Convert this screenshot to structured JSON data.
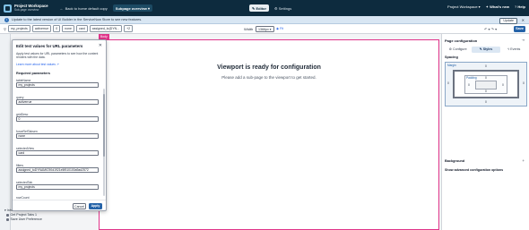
{
  "header": {
    "app_title": "Project Workspace",
    "app_subtitle": "Sub-page overview",
    "back_link": "Back to home default copy",
    "page_selector": "Subpage overview",
    "center_tabs": [
      {
        "label": "Editor",
        "active": true
      },
      {
        "label": "Settings",
        "active": false
      }
    ],
    "right_items": [
      "Project Workspace",
      "What's new",
      "Help"
    ]
  },
  "banner": {
    "text": "Update to the latest version of UI Builder in the ServiceNow Store to see new features.",
    "update_label": "Update",
    "close_icon": "close-icon"
  },
  "toolbar": {
    "chips": [
      "my_projects",
      "activerrue",
      "0",
      "none",
      "card",
      "assigned_to(DYN...",
      "+2"
    ],
    "width_label": "Width",
    "width_value": "1366px",
    "width_toggle": "Fit",
    "undo_label": "↶",
    "redo_label": "↷",
    "save_label": "Save"
  },
  "canvas": {
    "tag": "Body",
    "title": "Viewport is ready for configuration",
    "subtitle": "Please add a sub-page to the viewport to get started."
  },
  "dialog": {
    "title": "Edit test values for URL parameters",
    "description": "Apply test values for URL parameters to see how the content renders with the data.",
    "link": "Learn more about test values",
    "section": "Required parameters",
    "fields": [
      {
        "label": "tableName",
        "value": "my_projects"
      },
      {
        "label": "query",
        "value": "activerrue"
      },
      {
        "label": "gridDesc",
        "value": "0"
      },
      {
        "label": "forceRefTabsen",
        "value": "none"
      },
      {
        "label": "selectedView",
        "value": "card"
      },
      {
        "label": "filters",
        "value": "assigned_toDYNAMIC90d1921e5f510100a9ad2572"
      },
      {
        "label": "selectedTab",
        "value": "my_projects"
      },
      {
        "label": "rowCount",
        "value": ""
      }
    ],
    "cancel_label": "Cancel",
    "apply_label": "Apply"
  },
  "left_tree": {
    "items": [
      "Inherited data resources",
      "Get Project Tabs 1",
      "Save User Preference"
    ]
  },
  "right_panel": {
    "title": "Page configuration",
    "tabs": [
      {
        "label": "Configure",
        "active": false
      },
      {
        "label": "Styles",
        "active": true
      },
      {
        "label": "Events",
        "active": false
      }
    ],
    "spacing_label": "Spacing",
    "margin_label": "Margin",
    "padding_label": "Padding",
    "box_value": "0",
    "background_label": "Background",
    "advanced_label": "Show advanced configuration options"
  }
}
